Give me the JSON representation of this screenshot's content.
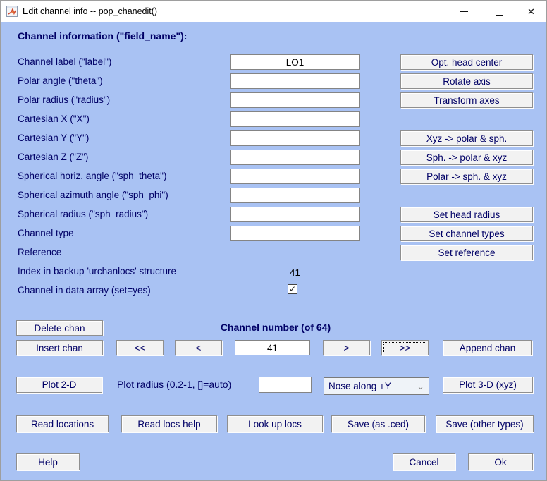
{
  "window": {
    "title": "Edit channel info -- pop_chanedit()",
    "app_icon": "matlab-logo"
  },
  "colors": {
    "background": "#a9c2f3",
    "label_text": "#000066",
    "button_face": "#f2f2f2",
    "button_text": "#000066",
    "edit_background": "#ffffff",
    "edit_text": "#000000",
    "titlebar": "#ffffff"
  },
  "icons": {
    "chevron_down": "⌄",
    "close": "✕",
    "checkmark": "✓"
  },
  "form": {
    "heading": "Channel information (\"field_name\"):",
    "rows": [
      {
        "label": "Channel label (\"label\")",
        "value": "LO1"
      },
      {
        "label": "Polar angle (\"theta\")",
        "value": ""
      },
      {
        "label": "Polar radius (\"radius\")",
        "value": ""
      },
      {
        "label": "Cartesian X (\"X\")",
        "value": ""
      },
      {
        "label": "Cartesian Y (\"Y\")",
        "value": ""
      },
      {
        "label": "Cartesian Z (\"Z\")",
        "value": ""
      },
      {
        "label": "Spherical horiz. angle (\"sph_theta\")",
        "value": ""
      },
      {
        "label": "Spherical azimuth angle (\"sph_phi\")",
        "value": ""
      },
      {
        "label": "Spherical radius (\"sph_radius\")",
        "value": ""
      },
      {
        "label": "Channel type",
        "value": ""
      },
      {
        "label": "Reference"
      }
    ],
    "index_row": {
      "label": "Index in backup 'urchanlocs' structure",
      "value": "41"
    },
    "checkbox_row": {
      "label": "Channel in data array (set=yes)",
      "checked": true
    },
    "side_buttons": [
      {
        "label": "Opt. head center"
      },
      {
        "label": "Rotate axis"
      },
      {
        "label": "Transform axes"
      },
      {
        "label": "Xyz -> polar & sph."
      },
      {
        "label": "Sph. -> polar & xyz"
      },
      {
        "label": "Polar -> sph. & xyz"
      },
      {
        "label": "Set head radius"
      },
      {
        "label": "Set channel types"
      },
      {
        "label": "Set reference"
      }
    ]
  },
  "channel_nav": {
    "heading": "Channel number (of 64)",
    "delete_label": "Delete chan",
    "insert_label": "Insert chan",
    "prev_fast_label": "<<",
    "prev_label": "<",
    "value": "41",
    "next_label": ">",
    "next_fast_label": ">>",
    "append_label": "Append chan"
  },
  "plot": {
    "plot2d_label": "Plot 2-D",
    "radius_label": "Plot radius (0.2-1, []=auto)",
    "radius_value": "",
    "nose_selected": "Nose along +Y",
    "plot3d_label": "Plot 3-D (xyz)"
  },
  "io": {
    "read_locations": "Read locations",
    "read_locs_help": "Read locs help",
    "look_up_locs": "Look up locs",
    "save_ced": "Save (as .ced)",
    "save_other": "Save (other types)"
  },
  "footer": {
    "help_label": "Help",
    "cancel_label": "Cancel",
    "ok_label": "Ok"
  }
}
